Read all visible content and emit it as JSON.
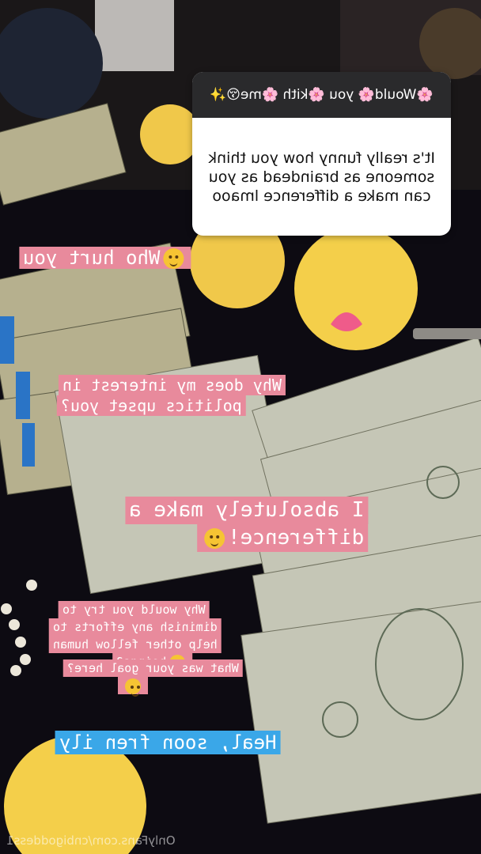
{
  "question": {
    "prompt": "🌸Would🌸 you 🌸kith 🌸me😚✨",
    "answer": "It's really funny how you think someone as braindead as you can make a difference lmaoo"
  },
  "captions": {
    "who_hurt": "Who hurt you",
    "why_line1": "Why does my interest in",
    "why_line2": "politics upset you?",
    "diff_line1": "I absolutely make a",
    "diff_line2": "difference!",
    "diminish_line1": "Why would you try to",
    "diminish_line2": "diminish any efforts to",
    "diminish_line3": "help other fellow human",
    "diminish_line4": "beings?",
    "goal": "What was your goal here?",
    "heal": "Heal, soon fren ily"
  },
  "footer": {
    "watermark": "OnlyFans.com/cnbigoddess1"
  },
  "colors": {
    "caption_pink": "#e88a9c",
    "caption_blue": "#3aa7e8",
    "card_header": "#2a2a2c"
  }
}
